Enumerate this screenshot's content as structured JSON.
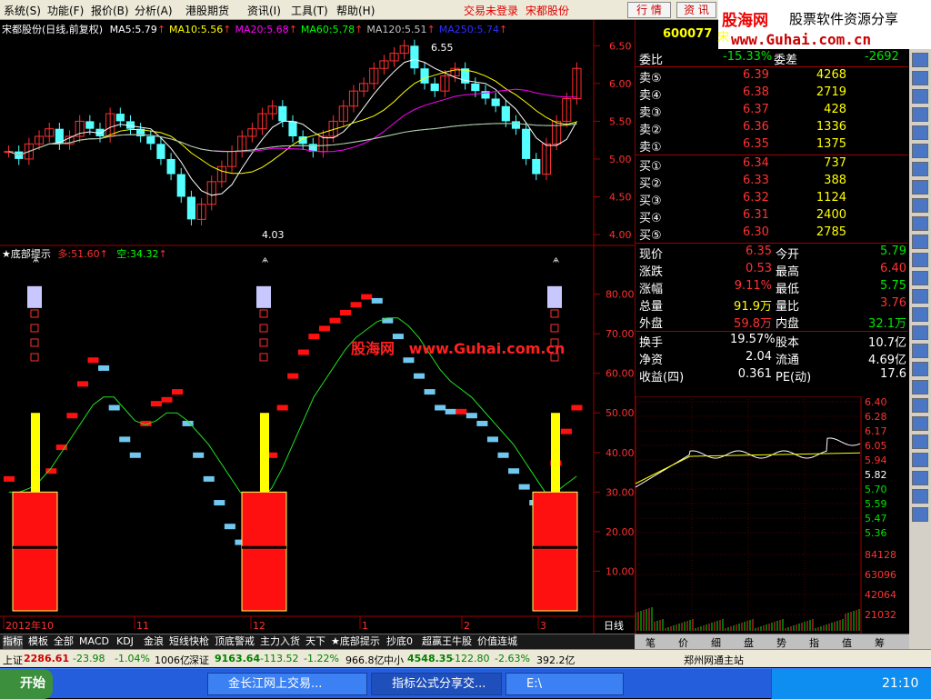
{
  "menu": {
    "items": [
      "系统(S)",
      "功能(F)",
      "报价(B)",
      "分析(A)",
      "港股期货",
      "资讯(I)",
      "工具(T)",
      "帮助(H)"
    ],
    "status": "交易未登录",
    "stock_name": "宋都股份",
    "btn_quote": "行 情",
    "btn_info": "资 讯"
  },
  "logo": {
    "brand": "股海网",
    "slogan": "股票软件资源分享",
    "url": "www.Guhai.com.cn"
  },
  "main_chart": {
    "title": "宋都股份(日线,前复权)",
    "ma": [
      {
        "label": "MA5:5.79",
        "color": "#ffffff"
      },
      {
        "label": "MA10:5.56",
        "color": "#ffff00"
      },
      {
        "label": "MA20:5.68",
        "color": "#ff00ff"
      },
      {
        "label": "MA60:5.78",
        "color": "#00ff00"
      },
      {
        "label": "MA120:5.51",
        "color": "#c0c0c0"
      },
      {
        "label": "MA250:5.74",
        "color": "#3030ff"
      }
    ],
    "y_ticks": [
      "6.50",
      "6.00",
      "5.50",
      "5.00",
      "4.50",
      "4.00"
    ],
    "high_label": "6.55",
    "low_label": "4.03"
  },
  "indicator": {
    "title": "★底部提示",
    "long_label": "多:51.60",
    "short_label": "空:34.32",
    "y_ticks": [
      "80.00",
      "70.00",
      "60.00",
      "50.00",
      "40.00",
      "30.00",
      "20.00",
      "10.00"
    ],
    "watermark_brand": "股海网",
    "watermark_url": "www.Guhai.com.cn"
  },
  "x_axis": {
    "labels": [
      "2012年10",
      "11",
      "12",
      "1",
      "2",
      "3"
    ],
    "period": "日线"
  },
  "chart_data": {
    "type": "line",
    "candles_close": [
      5.1,
      5.0,
      5.2,
      5.3,
      5.4,
      5.2,
      5.3,
      5.5,
      5.4,
      5.3,
      5.6,
      5.5,
      5.4,
      5.3,
      5.2,
      5.0,
      4.8,
      4.5,
      4.2,
      4.4,
      4.7,
      4.9,
      5.1,
      5.3,
      5.4,
      5.6,
      5.7,
      5.5,
      5.3,
      5.2,
      5.1,
      5.3,
      5.5,
      5.7,
      5.9,
      6.0,
      6.2,
      6.3,
      6.4,
      6.5,
      6.2,
      6.0,
      5.9,
      6.1,
      6.2,
      6.0,
      5.9,
      5.8,
      5.7,
      5.5,
      5.4,
      5.0,
      4.8,
      5.2,
      5.5,
      5.8,
      6.2
    ],
    "duo_line": [
      34,
      30,
      22,
      28,
      36,
      42,
      50,
      58,
      64,
      62,
      52,
      44,
      40,
      48,
      53,
      54,
      56,
      48,
      40,
      34,
      28,
      22,
      18,
      14,
      30,
      40,
      52,
      60,
      66,
      70,
      72,
      74,
      76,
      78,
      80,
      79,
      74,
      70,
      64,
      60,
      56,
      52,
      51,
      51,
      50,
      48,
      44,
      40,
      36,
      32,
      28,
      26,
      38,
      46,
      52
    ],
    "kong_line": [
      30,
      30,
      31,
      33,
      36,
      40,
      44,
      48,
      52,
      54,
      54,
      51,
      48,
      47,
      48,
      50,
      50,
      48,
      45,
      42,
      38,
      34,
      30,
      28,
      28,
      31,
      36,
      42,
      48,
      54,
      58,
      62,
      66,
      69,
      71,
      73,
      74,
      74,
      72,
      69,
      65,
      61,
      58,
      56,
      54,
      51,
      48,
      45,
      42,
      38,
      34,
      30,
      30,
      32,
      34
    ]
  },
  "quote": {
    "code": "600077",
    "name": "宋都股份",
    "wei_bi_label": "委比",
    "wei_bi": "-15.33%",
    "wei_cha_label": "委差",
    "wei_cha": "-2692",
    "sells": [
      {
        "label": "卖⑤",
        "price": "6.39",
        "vol": "4268"
      },
      {
        "label": "卖④",
        "price": "6.38",
        "vol": "2719"
      },
      {
        "label": "卖③",
        "price": "6.37",
        "vol": "428"
      },
      {
        "label": "卖②",
        "price": "6.36",
        "vol": "1336"
      },
      {
        "label": "卖①",
        "price": "6.35",
        "vol": "1375"
      }
    ],
    "buys": [
      {
        "label": "买①",
        "price": "6.34",
        "vol": "737"
      },
      {
        "label": "买②",
        "price": "6.33",
        "vol": "388"
      },
      {
        "label": "买③",
        "price": "6.32",
        "vol": "1124"
      },
      {
        "label": "买④",
        "price": "6.31",
        "vol": "2400"
      },
      {
        "label": "买⑤",
        "price": "6.30",
        "vol": "2785"
      }
    ],
    "stats": [
      {
        "l1": "现价",
        "v1": "6.35",
        "l2": "今开",
        "v2": "5.79"
      },
      {
        "l1": "涨跌",
        "v1": "0.53",
        "l2": "最高",
        "v2": "6.40"
      },
      {
        "l1": "涨幅",
        "v1": "9.11%",
        "l2": "最低",
        "v2": "5.75"
      },
      {
        "l1": "总量",
        "v1": "91.9万",
        "l2": "量比",
        "v2": "3.76"
      },
      {
        "l1": "外盘",
        "v1": "59.8万",
        "l2": "内盘",
        "v2": "32.1万"
      },
      {
        "l1": "换手",
        "v1": "19.57%",
        "l2": "股本",
        "v2": "10.7亿"
      },
      {
        "l1": "净资",
        "v1": "2.04",
        "l2": "流通",
        "v2": "4.69亿"
      },
      {
        "l1": "收益(四)",
        "v1": "0.361",
        "l2": "PE(动)",
        "v2": "17.6"
      }
    ],
    "intraday_ticks": [
      "6.40",
      "6.28",
      "6.17",
      "6.05",
      "5.94",
      "5.82",
      "5.70",
      "5.59",
      "5.47",
      "5.36"
    ],
    "vol_ticks": [
      "84128",
      "63096",
      "42064",
      "21032"
    ],
    "colors": {
      "up": "#ff3232",
      "down": "#00e600",
      "flat": "#ffffff"
    }
  },
  "tabs": [
    "指标",
    "模板",
    "全部",
    "MACD",
    "KDJ",
    "金浪",
    "短线快枪",
    "顶底警戒",
    "主力入货",
    "天下",
    "★底部提示",
    "抄底0",
    "超赢王牛股",
    "价值连城"
  ],
  "rtabs": [
    "笔",
    "价",
    "细",
    "盘",
    "势",
    "指",
    "值",
    "筹"
  ],
  "ticker": {
    "sh": "上证",
    "sh_v": "2286.61",
    "sh_c": "-23.98",
    "sh_p": "-1.04%",
    "sh_a": "1006亿",
    "sz": "深证",
    "sz_v": "9163.64",
    "sz_c": "-113.52",
    "sz_p": "-1.22%",
    "sz_a": "966.8亿",
    "zx": "中小",
    "zx_v": "4548.35",
    "zx_c": "-122.80",
    "zx_p": "-2.63%",
    "zx_a": "392.2亿",
    "server": "郑州网通主站"
  },
  "taskbar": {
    "start": "开始",
    "task1": "金长江网上交易...",
    "task2": "指标公式分享交...",
    "task3": "E:\\",
    "clock": "21:10"
  }
}
